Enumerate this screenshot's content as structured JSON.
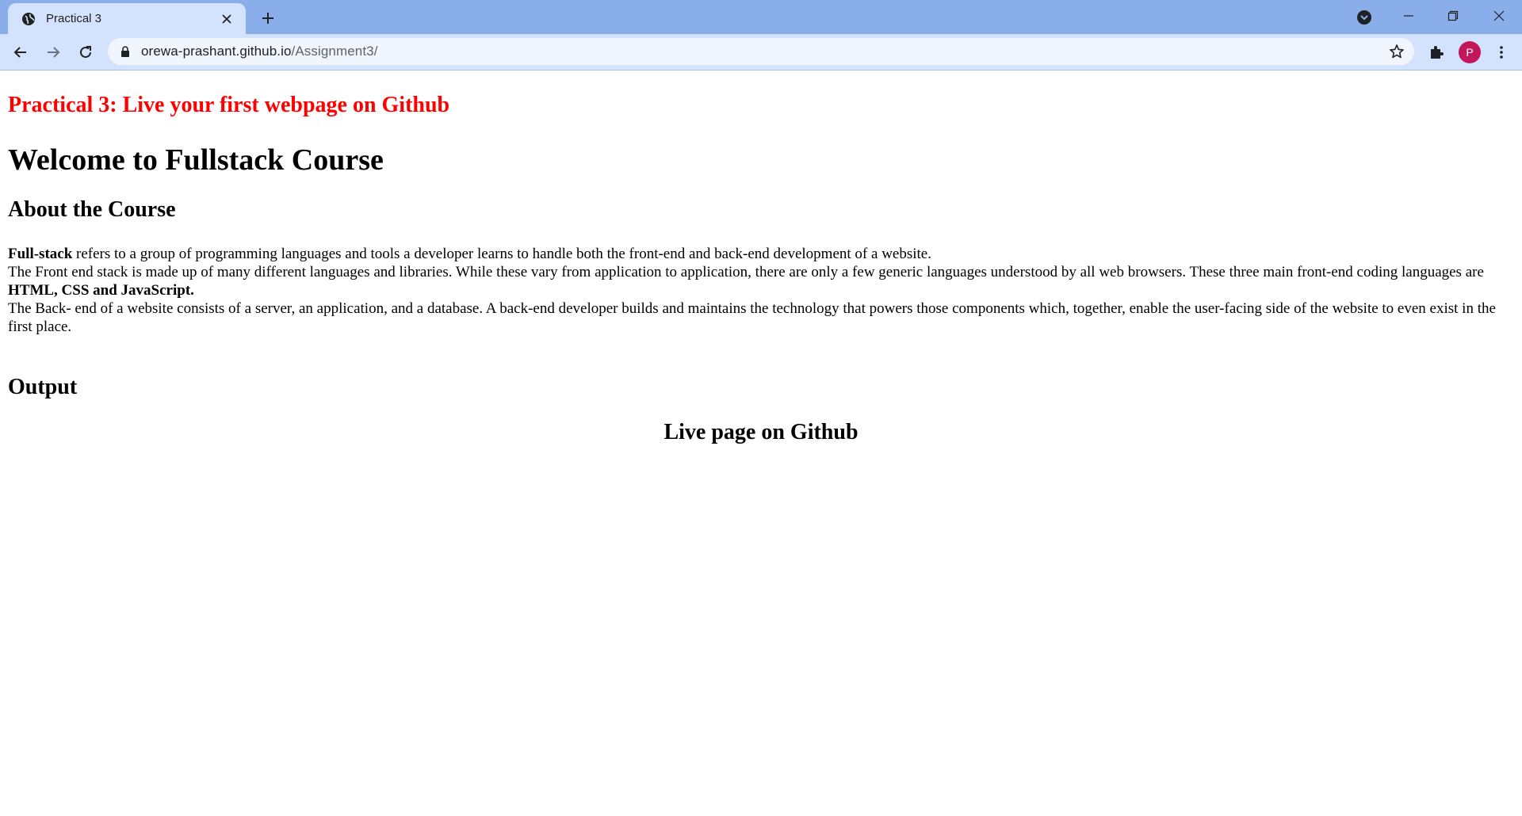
{
  "browser": {
    "tab_title": "Practical 3",
    "url_host": "orewa-prashant.github.io",
    "url_path": "/Assignment3/",
    "avatar_letter": "P",
    "colors": {
      "titlebar": "#8aaee9",
      "tab_active": "#d3e3fd",
      "avatar": "#c2185b"
    },
    "icons": [
      "globe-icon",
      "close-icon",
      "plus-icon",
      "tab-search-icon",
      "minimize-icon",
      "restore-icon",
      "window-close-icon",
      "back-arrow-icon",
      "forward-arrow-icon",
      "reload-icon",
      "lock-icon",
      "star-icon",
      "extensions-icon",
      "more-menu-icon"
    ]
  },
  "page": {
    "practical_title": "Practical 3: Live your first webpage on Github",
    "welcome_heading": "Welcome to Fullstack Course",
    "about_heading": "About the Course",
    "para1_bold": "Full-stack",
    "para1_rest": " refers to a group of programming languages and tools a developer learns to handle both the front-end and back-end development of a website.",
    "para2_text": "The Front end stack is made up of many different languages and libraries. While these vary from application to application, there are only a few generic languages understood by all web browsers. These three main front-end coding languages are ",
    "para2_bold": "HTML, CSS and JavaScript.",
    "para3_text": "The Back- end of a website consists of a server, an application, and a database. A back-end developer builds and maintains the technology that powers those components which, together, enable the user-facing side of the website to even exist in the first place.",
    "output_heading": "Output",
    "live_heading": "Live page on Github",
    "title_color": "#ff0000"
  }
}
